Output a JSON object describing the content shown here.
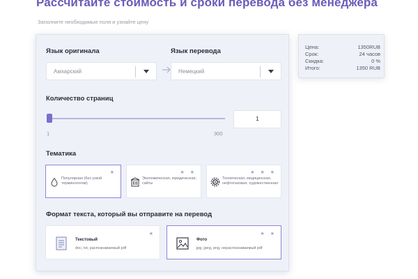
{
  "header": {
    "title": "Рассчитайте стоимость и сроки перевода без менеджера",
    "subtitle": "Заполните необходимые поля и узнайте цену"
  },
  "languages": {
    "source_label": "Язык оригинала",
    "source_value": "Амхарский",
    "target_label": "Язык перевода",
    "target_value": "Немецкий"
  },
  "pages": {
    "label": "Количество страниц",
    "min": "1",
    "max": "300",
    "value": "1",
    "slider_fraction": 0
  },
  "themes": {
    "label": "Тематика",
    "items": [
      {
        "text": "Популярная (без узкой терминологии)",
        "stars": "★",
        "icon": "water-drop-icon",
        "selected": true
      },
      {
        "text": "Экономическая, юридическая, сайты",
        "stars": "★ ★",
        "icon": "building-icon",
        "selected": false
      },
      {
        "text": "Техническая, медицинская, нефтегазовая, художественная",
        "stars": "★ ★ ★",
        "icon": "gear-icon",
        "selected": false
      }
    ]
  },
  "formats": {
    "label": "Формат текста, который вы отправите на перевод",
    "items": [
      {
        "title": "Текстовый",
        "desc": "doc, txt, распознаваемый pdf",
        "stars": "★",
        "icon": "document-icon",
        "selected": false
      },
      {
        "title": "Фото",
        "desc": "jpg, jpeg, png, нераспознаваемый pdf",
        "stars": "★ ★",
        "icon": "image-icon",
        "selected": true
      }
    ]
  },
  "summary": {
    "price_label": "Цена:",
    "price_value": "1350RUB",
    "term_label": "Срок:",
    "term_value": "24 часов",
    "discount_label": "Скидка:",
    "discount_value": "0 %",
    "total_label": "Итого:",
    "total_value": "1350 RUB"
  },
  "colors": {
    "accent": "#6c5bb8",
    "selected_border": "#8f84d6",
    "star": "#9aa2cf"
  }
}
